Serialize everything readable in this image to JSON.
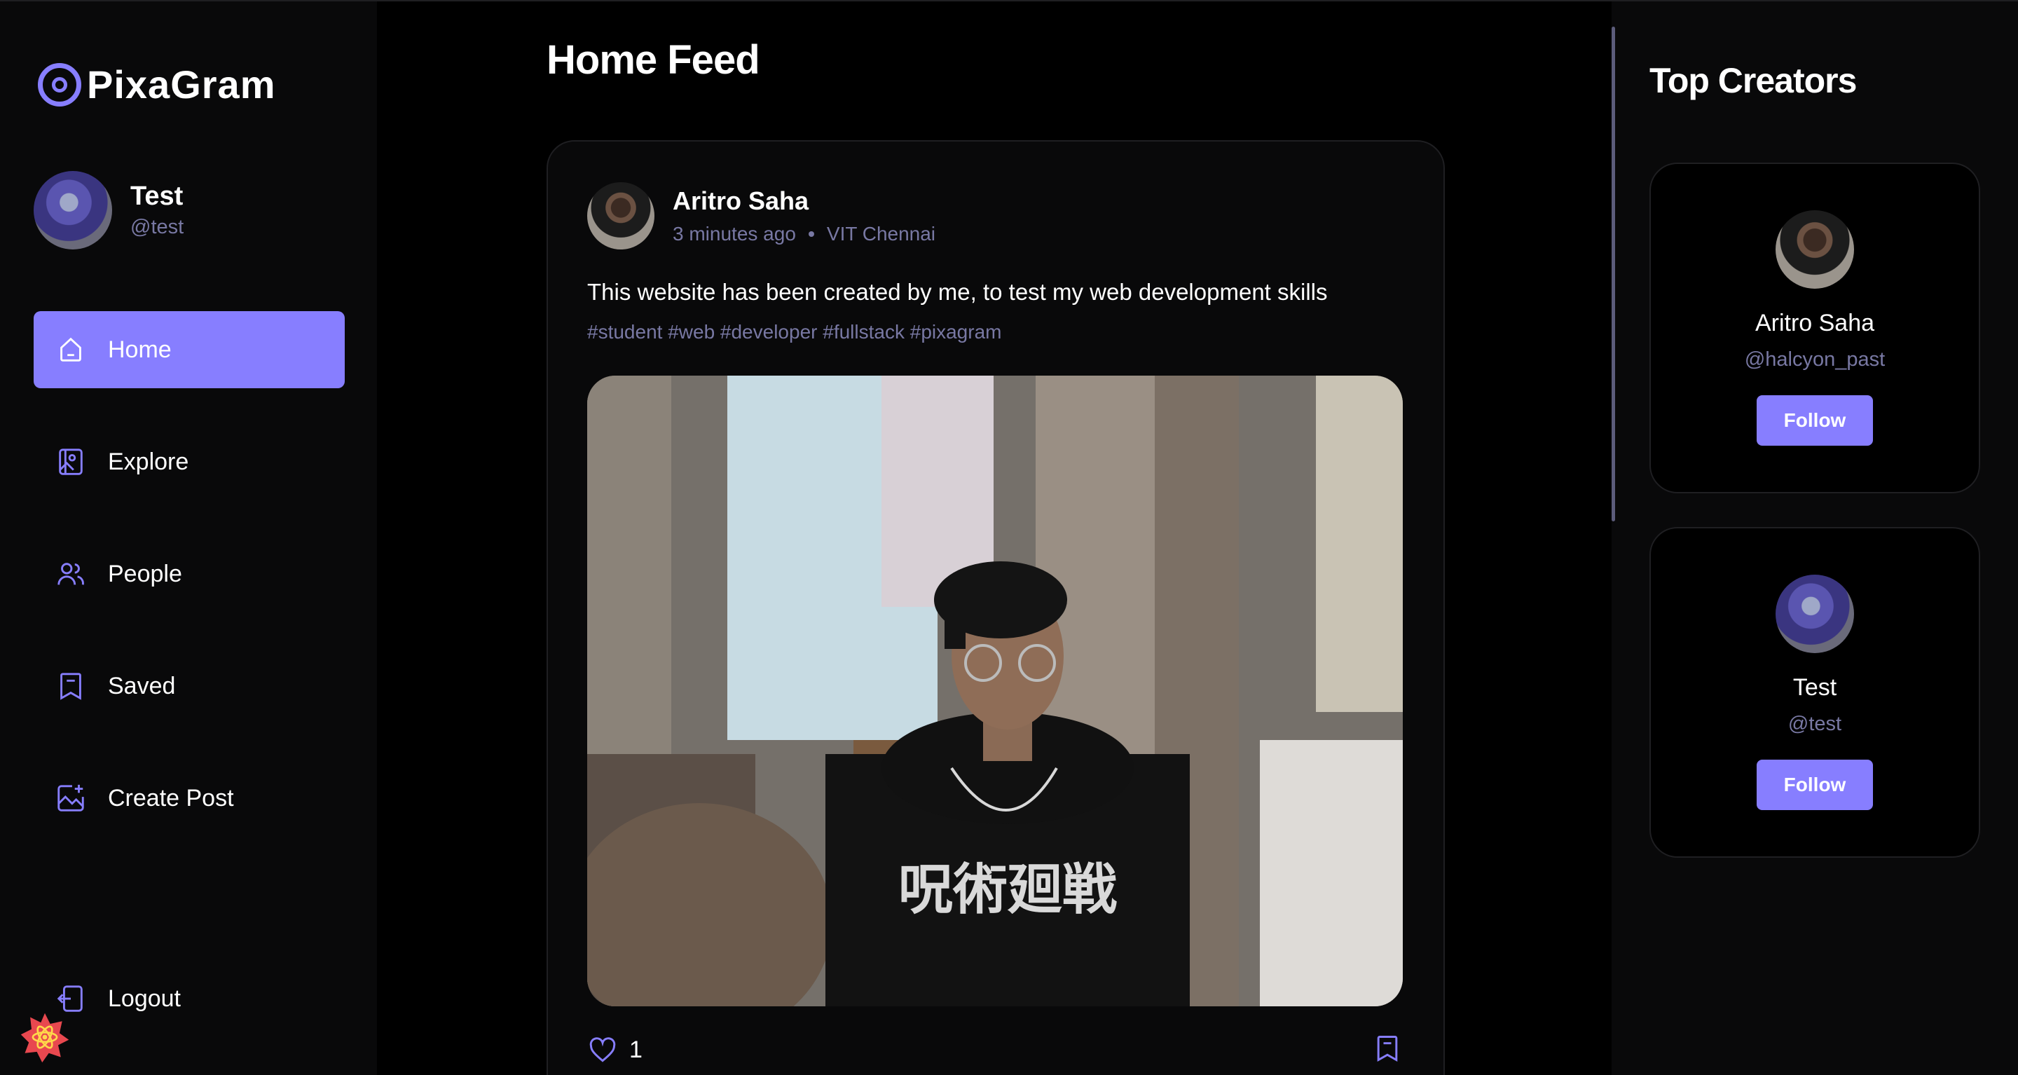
{
  "brand": {
    "name": "PixaGram",
    "accent": "#877EFF"
  },
  "user": {
    "name": "Test",
    "handle": "@test"
  },
  "nav": {
    "items": [
      {
        "label": "Home",
        "icon": "home-icon",
        "active": true
      },
      {
        "label": "Explore",
        "icon": "gallery-icon",
        "active": false
      },
      {
        "label": "People",
        "icon": "people-icon",
        "active": false
      },
      {
        "label": "Saved",
        "icon": "bookmark-icon",
        "active": false
      },
      {
        "label": "Create Post",
        "icon": "add-image-icon",
        "active": false
      }
    ],
    "logout_label": "Logout"
  },
  "feed": {
    "title": "Home Feed",
    "post": {
      "author": "Aritro Saha",
      "time": "3 minutes ago",
      "location": "VIT Chennai",
      "caption": "This website has been created by me, to test my web development skills",
      "tags": "#student #web #developer #fullstack #pixagram",
      "likes": "1"
    }
  },
  "top_creators": {
    "title": "Top Creators",
    "creators": [
      {
        "name": "Aritro Saha",
        "handle": "@halcyon_past",
        "button": "Follow"
      },
      {
        "name": "Test",
        "handle": "@test",
        "button": "Follow"
      }
    ]
  }
}
